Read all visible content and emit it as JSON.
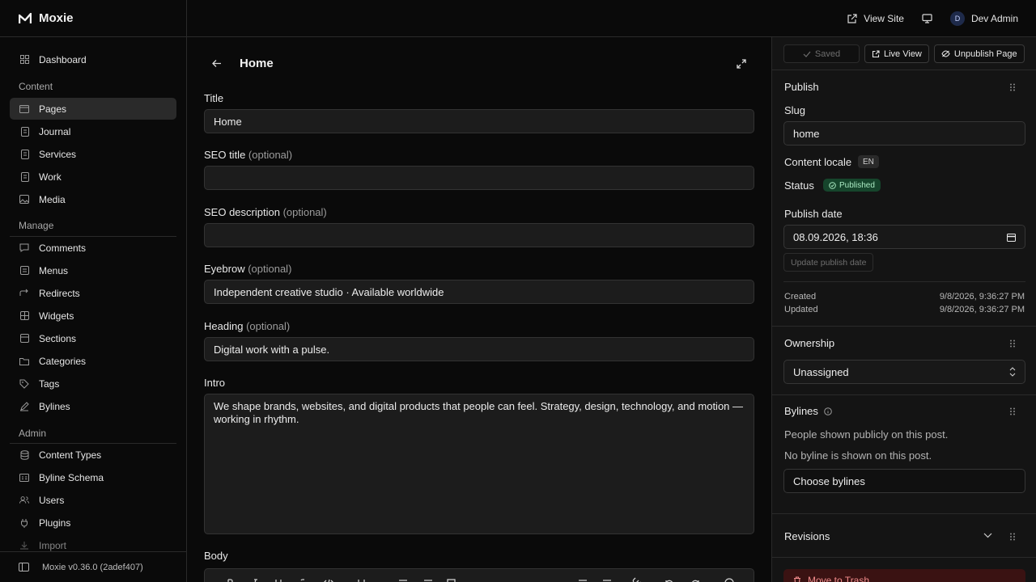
{
  "app": {
    "name": "Moxie"
  },
  "topbar": {
    "view_site": "View Site",
    "user_initial": "D",
    "user_name": "Dev Admin"
  },
  "sidebar": {
    "dashboard": "Dashboard",
    "sections": {
      "content": "Content",
      "manage": "Manage",
      "admin": "Admin"
    },
    "content_items": [
      "Pages",
      "Journal",
      "Services",
      "Work",
      "Media"
    ],
    "manage_items": [
      "Comments",
      "Menus",
      "Redirects",
      "Widgets",
      "Sections",
      "Categories",
      "Tags",
      "Bylines"
    ],
    "admin_items": [
      "Content Types",
      "Byline Schema",
      "Users",
      "Plugins",
      "Import"
    ],
    "active_item": "Pages",
    "version": "Moxie v0.36.0 (2adef407)"
  },
  "editor": {
    "page_title": "Home",
    "optional_suffix": "(optional)",
    "fields": {
      "title": {
        "label": "Title",
        "value": "Home"
      },
      "seo_title": {
        "label": "SEO title",
        "value": ""
      },
      "seo_description": {
        "label": "SEO description",
        "value": ""
      },
      "eyebrow": {
        "label": "Eyebrow",
        "value": "Independent creative studio · Available worldwide"
      },
      "heading": {
        "label": "Heading",
        "value": "Digital work with a pulse."
      },
      "intro": {
        "label": "Intro",
        "value": "We shape brands, websites, and digital products that people can feel. Strategy, design, technology, and motion —working in rhythm."
      },
      "body": {
        "label": "Body"
      }
    }
  },
  "panel": {
    "actions": {
      "saved": "Saved",
      "live_view": "Live View",
      "unpublish": "Unpublish Page"
    },
    "publish": {
      "title": "Publish",
      "slug_label": "Slug",
      "slug_value": "home",
      "locale_label": "Content locale",
      "locale_value": "EN",
      "status_label": "Status",
      "status_value": "Published",
      "publish_date_label": "Publish date",
      "publish_date_value": "08.09.2026, 18:36",
      "update_date_button": "Update publish date",
      "created_label": "Created",
      "created_value": "9/8/2026, 9:36:27 PM",
      "updated_label": "Updated",
      "updated_value": "9/8/2026, 9:36:27 PM"
    },
    "ownership": {
      "title": "Ownership",
      "value": "Unassigned"
    },
    "bylines": {
      "title": "Bylines",
      "description": "People shown publicly on this post.",
      "empty": "No byline is shown on this post.",
      "choose_button": "Choose bylines"
    },
    "revisions": {
      "title": "Revisions"
    },
    "trash_button": "Move to Trash"
  },
  "colors": {
    "background": "#0a0a0a",
    "panel": "#141414",
    "input": "#1c1c1c",
    "published_badge": "#16452c",
    "danger": "#3a1212"
  }
}
